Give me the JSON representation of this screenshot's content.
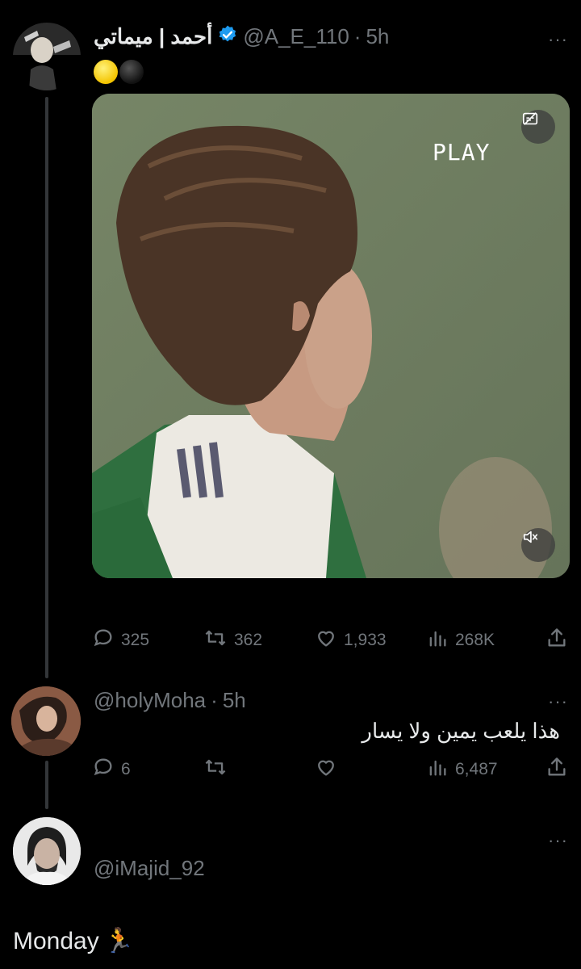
{
  "tweet": {
    "author_name": "أحمد | ميماتي",
    "handle": "@A_E_110",
    "separator": "·",
    "time": "5h",
    "more_label": "···",
    "media": {
      "overlay_text": "PLAY"
    },
    "stats": {
      "replies": "325",
      "reposts": "362",
      "likes": "1,933",
      "views": "268K"
    }
  },
  "reply": {
    "handle": "@holyMoha",
    "separator": "·",
    "time": "5h",
    "more_label": "···",
    "text": "هذا يلعب يمين ولا يسار",
    "stats": {
      "replies": "6",
      "views": "6,487"
    }
  },
  "reply2": {
    "handle": "@iMajid_92",
    "more_label": "···",
    "text": "Monday",
    "emoji": "🏃"
  },
  "colors": {
    "background": "#000000",
    "text_primary": "#e7e9ea",
    "text_secondary": "#71767b",
    "verified": "#1d9bf0",
    "thread_line": "#333639"
  }
}
